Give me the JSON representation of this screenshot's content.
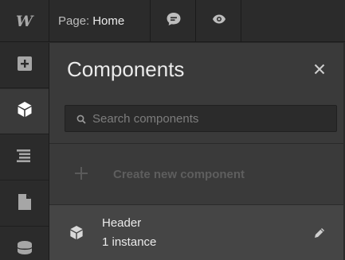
{
  "app": {
    "logo_text": "W",
    "accent_color": "#ebebeb"
  },
  "topbar": {
    "page_prefix": "Page:",
    "page_name": "Home",
    "comments_icon": "comment-icon",
    "preview_icon": "eye-icon"
  },
  "rail": {
    "items": [
      {
        "icon": "add-icon",
        "active": false
      },
      {
        "icon": "components-icon",
        "active": true
      },
      {
        "icon": "navigator-icon",
        "active": false
      },
      {
        "icon": "pages-icon",
        "active": false
      },
      {
        "icon": "cms-icon",
        "active": false
      }
    ]
  },
  "panel": {
    "title": "Components",
    "close_icon": "close-icon",
    "search": {
      "placeholder": "Search components",
      "value": ""
    },
    "create": {
      "icon": "plus-icon",
      "label": "Create new component"
    },
    "components": [
      {
        "name": "Header",
        "count": "1 instance",
        "icon": "component-cube-icon",
        "action_icon": "pencil-icon"
      }
    ]
  }
}
